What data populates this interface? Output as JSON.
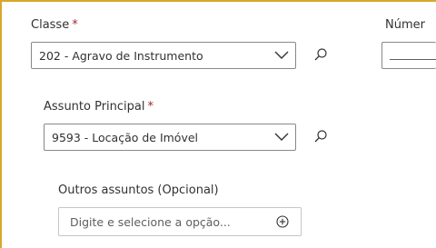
{
  "classe": {
    "label": "Classe",
    "required_mark": "*",
    "value": "202 - Agravo de Instrumento",
    "chevron_icon": "chevron-down-icon",
    "search_icon": "search-icon"
  },
  "numero": {
    "label": "Númer"
  },
  "assunto_principal": {
    "label": "Assunto Principal",
    "required_mark": "*",
    "value": "9593 - Locação de Imóvel",
    "chevron_icon": "chevron-down-icon",
    "search_icon": "search-icon"
  },
  "outros_assuntos": {
    "label": "Outros assuntos (Opcional)",
    "placeholder": "Digite e selecione a opção...",
    "add_icon": "add-circle-icon"
  },
  "colors": {
    "frame_border": "#d8a82a",
    "required": "#a4262c",
    "text": "#323130",
    "field_border": "#8a8886"
  }
}
